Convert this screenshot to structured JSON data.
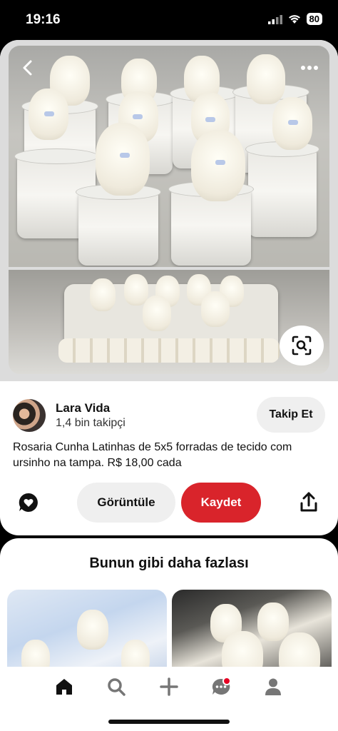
{
  "status_bar": {
    "time": "19:16",
    "battery": "80"
  },
  "pin": {
    "author": {
      "name": "Lara Vida",
      "followers": "1,4 bin takipçi",
      "follow_label": "Takip Et"
    },
    "description": "Rosaria Cunha Latinhas de 5x5 forradas de tecido com ursinho na tampa. R$ 18,00 cada",
    "view_label": "Görüntüle",
    "save_label": "Kaydet"
  },
  "more_like_this": {
    "title": "Bunun gibi daha fazlası"
  },
  "colors": {
    "save_button": "#d9242b",
    "secondary_button": "#efefef",
    "notification_dot": "#e60023"
  },
  "icons": {
    "back": "chevron-left-icon",
    "more": "more-horizontal-icon",
    "lens": "visual-search-icon",
    "comment": "comment-heart-icon",
    "share": "share-icon",
    "tabs": [
      "home-icon",
      "search-icon",
      "plus-icon",
      "messages-icon",
      "profile-icon"
    ]
  }
}
